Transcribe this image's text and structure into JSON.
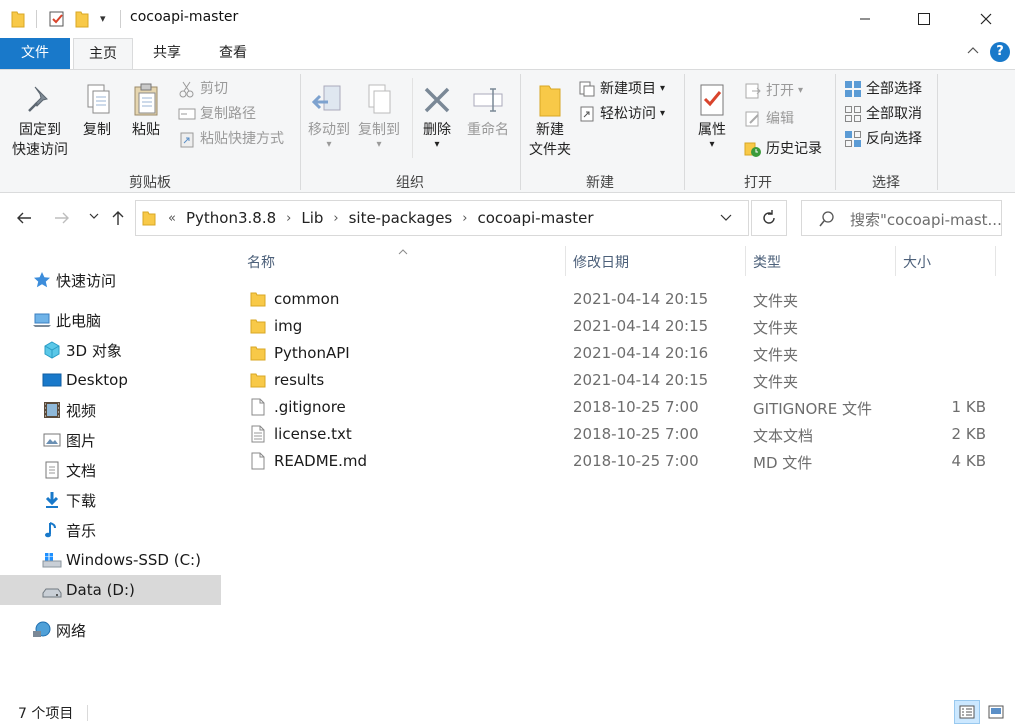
{
  "window": {
    "title": "cocoapi-master",
    "controls": {
      "minimize": "—",
      "maximize": "☐",
      "close": "✕"
    }
  },
  "ribbon_tabs": {
    "file": "文件",
    "home": "主页",
    "share": "共享",
    "view": "查看",
    "help": "?"
  },
  "ribbon": {
    "clipboard": {
      "label": "剪贴板",
      "pin_line1": "固定到",
      "pin_line2": "快速访问",
      "copy": "复制",
      "paste": "粘贴",
      "cut": "剪切",
      "copy_path": "复制路径",
      "paste_shortcut": "粘贴快捷方式"
    },
    "organize": {
      "label": "组织",
      "move_to": "移动到",
      "copy_to": "复制到",
      "delete": "删除",
      "rename": "重命名"
    },
    "new": {
      "label": "新建",
      "new_folder_line1": "新建",
      "new_folder_line2": "文件夹",
      "new_item": "新建项目",
      "easy_access": "轻松访问"
    },
    "open": {
      "label": "打开",
      "properties": "属性",
      "open": "打开",
      "edit": "编辑",
      "history": "历史记录"
    },
    "select": {
      "label": "选择",
      "select_all": "全部选择",
      "select_none": "全部取消",
      "invert": "反向选择"
    }
  },
  "address": {
    "overflow": "«",
    "crumbs": [
      "Python3.8.8",
      "Lib",
      "site-packages",
      "cocoapi-master"
    ],
    "separator": "›"
  },
  "search": {
    "placeholder": "搜索\"cocoapi-mast..."
  },
  "nav_pane": {
    "quick_access": "快速访问",
    "this_pc": "此电脑",
    "objects3d": "3D 对象",
    "desktop": "Desktop",
    "videos": "视频",
    "pictures": "图片",
    "documents": "文档",
    "downloads": "下载",
    "music": "音乐",
    "drive_c": "Windows-SSD (C:)",
    "drive_d": "Data (D:)",
    "network": "网络"
  },
  "columns": {
    "name": "名称",
    "modified": "修改日期",
    "type": "类型",
    "size": "大小"
  },
  "files": [
    {
      "name": "common",
      "modified": "2021-04-14 20:15",
      "type": "文件夹",
      "size": "",
      "icon": "folder-icon"
    },
    {
      "name": "img",
      "modified": "2021-04-14 20:15",
      "type": "文件夹",
      "size": "",
      "icon": "folder-icon"
    },
    {
      "name": "PythonAPI",
      "modified": "2021-04-14 20:16",
      "type": "文件夹",
      "size": "",
      "icon": "folder-icon"
    },
    {
      "name": "results",
      "modified": "2021-04-14 20:15",
      "type": "文件夹",
      "size": "",
      "icon": "folder-icon"
    },
    {
      "name": ".gitignore",
      "modified": "2018-10-25 7:00",
      "type": "GITIGNORE 文件",
      "size": "1 KB",
      "icon": "file-icon"
    },
    {
      "name": "license.txt",
      "modified": "2018-10-25 7:00",
      "type": "文本文档",
      "size": "2 KB",
      "icon": "text-file-icon"
    },
    {
      "name": "README.md",
      "modified": "2018-10-25 7:00",
      "type": "MD 文件",
      "size": "4 KB",
      "icon": "file-icon"
    }
  ],
  "status": {
    "item_count": "7 个项目"
  },
  "colors": {
    "accent": "#1979ca",
    "folder": "#f8c948",
    "selected_nav": "#d9d9d9",
    "ribbon_bg": "#f5f6f7"
  }
}
